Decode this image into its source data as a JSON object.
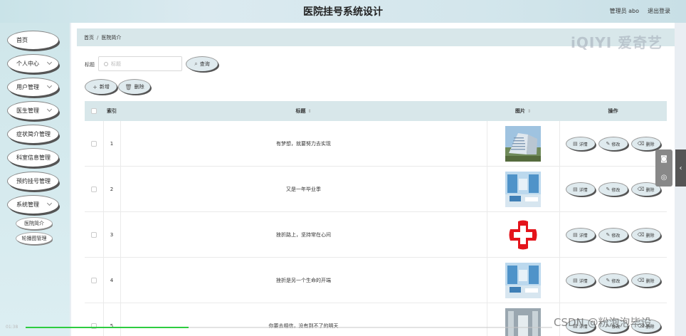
{
  "header": {
    "title": "医院挂号系统设计",
    "admin": "管理员 abo",
    "logout": "退出登录"
  },
  "sidebar": {
    "items": [
      {
        "label": "首页",
        "chevron": false
      },
      {
        "label": "个人中心",
        "chevron": true
      },
      {
        "label": "用户管理",
        "chevron": true
      },
      {
        "label": "医生管理",
        "chevron": true
      },
      {
        "label": "症状简介管理",
        "chevron": false
      },
      {
        "label": "科室信息管理",
        "chevron": false
      },
      {
        "label": "预约挂号管理",
        "chevron": false
      },
      {
        "label": "系统管理",
        "chevron": true
      }
    ],
    "subitems": [
      {
        "label": "医院简介"
      },
      {
        "label": "轮播图管理"
      }
    ]
  },
  "breadcrumb": {
    "home": "首页",
    "sep": "/",
    "current": "医院简介"
  },
  "search": {
    "label": "标题",
    "placeholder": "标题",
    "button": "查询"
  },
  "toolbar": {
    "add": "新增",
    "delete": "删除"
  },
  "table": {
    "headers": {
      "index": "索引",
      "title": "标题",
      "image": "图片",
      "actions": "操作"
    },
    "rows": [
      {
        "index": "1",
        "title": "有梦想，就要努力去实现",
        "image": "hospital-building"
      },
      {
        "index": "2",
        "title": "又是一年毕业季",
        "image": "clinic-room"
      },
      {
        "index": "3",
        "title": "挫折路上，坚持常在心间",
        "image": "red-cross"
      },
      {
        "index": "4",
        "title": "挫折是另一个生命的开端",
        "image": "clinic-room"
      },
      {
        "index": "5",
        "title": "你要去相信，没有到不了的明天",
        "image": "corridor"
      }
    ],
    "row_actions": {
      "detail": "详情",
      "edit": "修改",
      "delete": "删除"
    }
  },
  "overlay": {
    "watermark_top": "iQIYI 爱奇艺",
    "watermark_bottom": "CSDN @粉泡泡毕设",
    "time": "01:38",
    "progress": 0.31
  },
  "colors": {
    "header_bg": "#d3e6ec",
    "sidebar_bg": "#d5eaee",
    "accent": "#dfeaee",
    "table_header": "#d8e7ea",
    "progress": "#2ecc40"
  }
}
